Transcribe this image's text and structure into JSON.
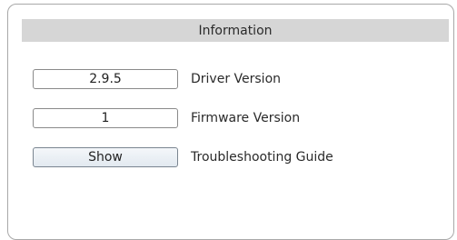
{
  "section": {
    "title": "Information"
  },
  "rows": [
    {
      "value": "2.9.5",
      "label": "Driver Version"
    },
    {
      "value": "1",
      "label": "Firmware Version"
    },
    {
      "value": "Show",
      "label": "Troubleshooting Guide"
    }
  ]
}
